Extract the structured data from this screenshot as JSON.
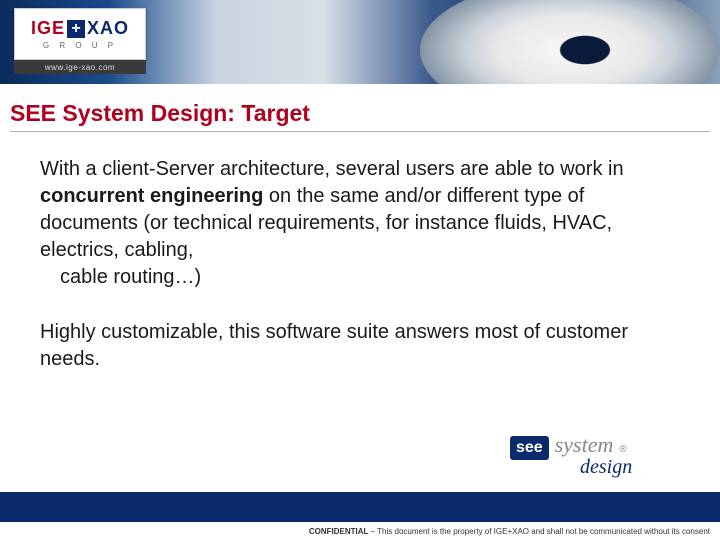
{
  "header": {
    "logo_ige": "IGE",
    "logo_plus": "+",
    "logo_xao": "XAO",
    "logo_group": "G R O U P",
    "logo_url": "www.ige-xao.com"
  },
  "slide": {
    "title": "SEE System Design: Target",
    "para1_part1": "With a client-Server architecture, several users are able to work in ",
    "para1_bold": "concurrent engineering",
    "para1_part2": " on the same and/or different type of documents (or technical requirements, for instance fluids, HVAC, electrics, cabling,",
    "para1_indent": "cable routing…)",
    "para2": "Highly customizable, this software suite answers most of customer needs."
  },
  "product_logo": {
    "see": "see",
    "system": "system",
    "reg": "®",
    "design": "design"
  },
  "footer": {
    "conf_label": "CONFIDENTIAL",
    "conf_text": " – This document is the property of IGE+XAO and shall not be communicated without its consent"
  }
}
